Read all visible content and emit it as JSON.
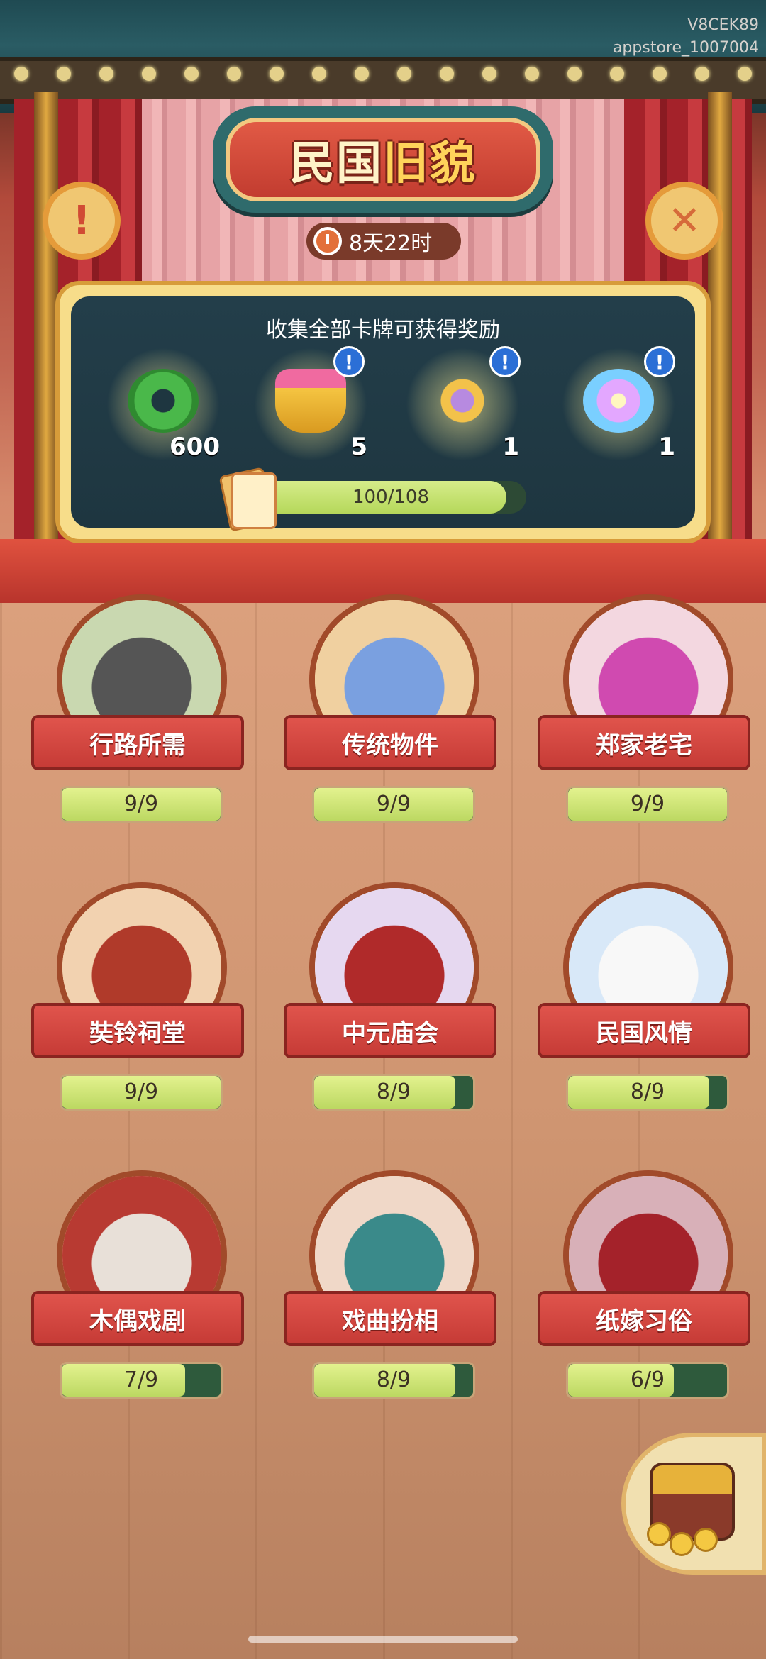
{
  "watermark": {
    "line1": "V8CEK89",
    "line2": "appstore_1007004"
  },
  "title": {
    "part1": "民国",
    "part2": "旧貌"
  },
  "timer": {
    "label": "8天22时"
  },
  "buttons": {
    "info": "!",
    "close": "✕"
  },
  "rewards": {
    "title": "收集全部卡牌可获得奖励",
    "items": [
      {
        "icon": "jade-coin-icon",
        "count": "600",
        "has_info": false
      },
      {
        "icon": "treasure-bowl-icon",
        "count": "5",
        "has_info": true
      },
      {
        "icon": "golden-key-icon",
        "count": "1",
        "has_info": true
      },
      {
        "icon": "magic-orb-icon",
        "count": "1",
        "has_info": true
      }
    ],
    "info_badge": "!",
    "progress": {
      "current": 100,
      "total": 108,
      "text": "100/108"
    }
  },
  "categories": [
    {
      "name": "行路所需",
      "progress": "9/9",
      "fraction": 1.0,
      "icon": "rickshaw-icon"
    },
    {
      "name": "传统物件",
      "progress": "9/9",
      "fraction": 1.0,
      "icon": "butterfly-box-icon"
    },
    {
      "name": "郑家老宅",
      "progress": "9/9",
      "fraction": 1.0,
      "icon": "spider-lily-icon"
    },
    {
      "name": "奘铃祠堂",
      "progress": "9/9",
      "fraction": 1.0,
      "icon": "gold-egg-bowl-icon"
    },
    {
      "name": "中元庙会",
      "progress": "8/9",
      "fraction": 0.889,
      "icon": "lantern-icon"
    },
    {
      "name": "民国风情",
      "progress": "8/9",
      "fraction": 0.889,
      "icon": "lace-gloves-icon"
    },
    {
      "name": "木偶戏剧",
      "progress": "7/9",
      "fraction": 0.778,
      "icon": "puppet-icon"
    },
    {
      "name": "戏曲扮相",
      "progress": "8/9",
      "fraction": 0.889,
      "icon": "opera-girl-icon"
    },
    {
      "name": "纸嫁习俗",
      "progress": "6/9",
      "fraction": 0.667,
      "icon": "paper-bride-icon"
    }
  ],
  "treasure_button": {
    "icon": "treasure-chest-icon"
  },
  "colors": {
    "accent": "#c63b36",
    "panel": "#233e4a",
    "progress": "#bcd862"
  }
}
